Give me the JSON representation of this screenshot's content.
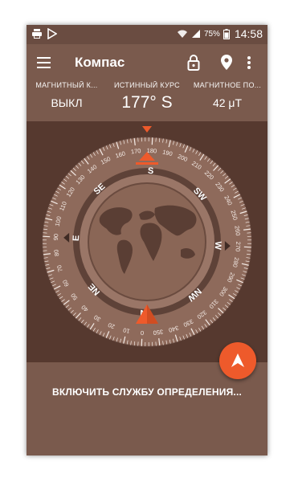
{
  "status_bar": {
    "battery": "75%",
    "time": "14:58"
  },
  "app": {
    "title": "Компас"
  },
  "stats": [
    {
      "label": "МАГНИТНЫЙ К...",
      "value": "ВЫКЛ"
    },
    {
      "label": "ИСТИННЫЙ КУРС",
      "value": "177° S"
    },
    {
      "label": "МАГНИТНОЕ ПО...",
      "value": "42 μT"
    }
  ],
  "compass": {
    "directions": [
      "S",
      "SW",
      "W",
      "NW",
      "N",
      "NE",
      "E",
      "SE"
    ],
    "degree_labels": [
      "0",
      "10",
      "20",
      "30",
      "40",
      "50",
      "60",
      "70",
      "80",
      "90",
      "100",
      "110",
      "120",
      "130",
      "140",
      "150",
      "160",
      "170",
      "180",
      "190",
      "200",
      "210",
      "220",
      "230",
      "240",
      "250",
      "260",
      "270",
      "280",
      "290",
      "300",
      "310",
      "320",
      "330",
      "340",
      "350"
    ],
    "heading_deg": 177
  },
  "actions": {
    "enable_location": "ВКЛЮЧИТЬ СЛУЖБУ ОПРЕДЕЛЕНИЯ..."
  },
  "colors": {
    "accent": "#ee5a2b",
    "primary": "#7a5a4d",
    "dark": "#56392f"
  }
}
